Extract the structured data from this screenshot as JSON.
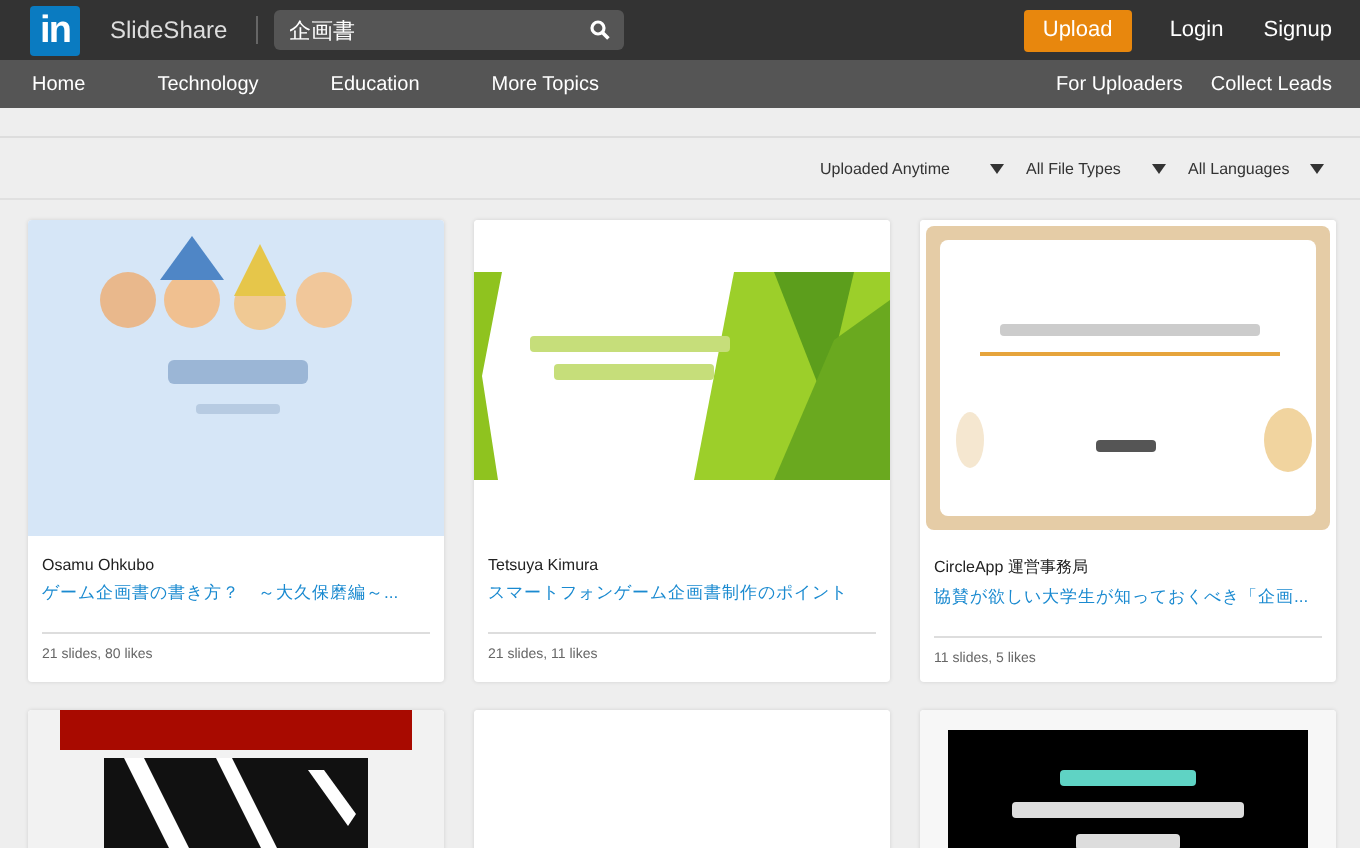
{
  "header": {
    "logo": "in",
    "brand": "SlideShare",
    "search": {
      "value": "企画書"
    },
    "upload": "Upload",
    "links": [
      "Login",
      "Signup"
    ]
  },
  "nav": {
    "left": [
      "Home",
      "Technology",
      "Education",
      "More Topics"
    ],
    "right": [
      "For Uploaders",
      "Collect Leads"
    ]
  },
  "filters": [
    "Uploaded Anytime",
    "All File Types",
    "All Languages"
  ],
  "cards": [
    {
      "thumbnail": {
        "kind": "picture"
      },
      "author": "Osamu Ohkubo",
      "title": "ゲーム企画書の書き方？　～大久保磨編～...",
      "stats": "21 slides, 80 likes"
    },
    {
      "thumbnail": {
        "kind": "picture"
      },
      "author": "Tetsuya Kimura",
      "title": "スマートフォンゲーム企画書制作のポイント",
      "stats": "21 slides, 11 likes"
    },
    {
      "thumbnail": {
        "kind": "picture"
      },
      "author": "CircleApp 運営事務局",
      "title": "協賛が欲しい大学生が知っておくべき「企画...",
      "stats": "11 slides, 5 likes"
    },
    {
      "thumbnail": {
        "kind": "picture"
      }
    },
    {
      "thumbnail": {
        "kind": "blank"
      }
    },
    {
      "thumbnail": {
        "kind": "picture"
      }
    }
  ]
}
